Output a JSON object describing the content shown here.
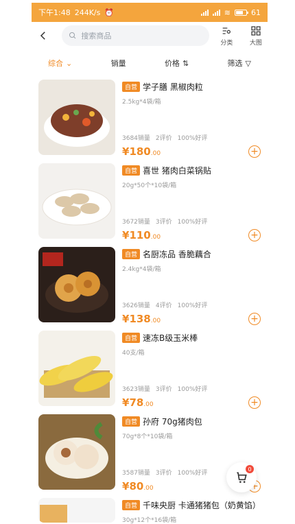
{
  "status": {
    "time": "下午1:48",
    "speed": "244K/s",
    "battery": "61"
  },
  "topbar": {
    "search_placeholder": "搜索商品",
    "category_label": "分类",
    "bigview_label": "大图"
  },
  "sort": {
    "all": "综合",
    "sales": "销量",
    "price": "价格",
    "filter": "筛选"
  },
  "products": [
    {
      "tag": "自营",
      "title": "学子膳 黑椒肉粒",
      "spec": "2.5kg*4袋/箱",
      "sales": "3684销量",
      "reviews": "2评价",
      "good": "100%好评",
      "price_main": "180",
      "price_dec": ".00",
      "img_colors": [
        "#e7e1d4",
        "#7e3e2a"
      ]
    },
    {
      "tag": "自营",
      "title": "喜世 猪肉白菜锅贴",
      "spec": "20g*50个*10袋/箱",
      "sales": "3672销量",
      "reviews": "3评价",
      "good": "100%好评",
      "price_main": "110",
      "price_dec": ".00",
      "img_colors": [
        "#f0ede9",
        "#d8c7ab"
      ]
    },
    {
      "tag": "自营",
      "title": "名厨冻品 香脆藕合",
      "spec": "2.4kg*4袋/箱",
      "sales": "3626销量",
      "reviews": "4评价",
      "good": "100%好评",
      "price_main": "138",
      "price_dec": ".00",
      "img_colors": [
        "#2b1f1a",
        "#e1a44a"
      ]
    },
    {
      "tag": "自营",
      "title": "速冻B级玉米棒",
      "spec": "40支/箱",
      "sales": "3623销量",
      "reviews": "3评价",
      "good": "100%好评",
      "price_main": "78",
      "price_dec": ".00",
      "img_colors": [
        "#f4f1ea",
        "#f1d24a"
      ]
    },
    {
      "tag": "自营",
      "title": "孙府 70g猪肉包",
      "spec": "70g*8个*10袋/箱",
      "sales": "3587销量",
      "reviews": "3评价",
      "good": "100%好评",
      "price_main": "80",
      "price_dec": ".00",
      "img_colors": [
        "#8a6a3e",
        "#f5efe2"
      ]
    },
    {
      "tag": "自营",
      "title": "千味央厨 卡通猪猪包（奶黄馅）",
      "spec": "30g*12个*16袋/箱",
      "sales": "",
      "reviews": "",
      "good": "",
      "price_main": "",
      "price_dec": "",
      "img_colors": [
        "#e8b25f",
        "#f5f5f5"
      ]
    }
  ],
  "cart": {
    "badge": "0"
  }
}
